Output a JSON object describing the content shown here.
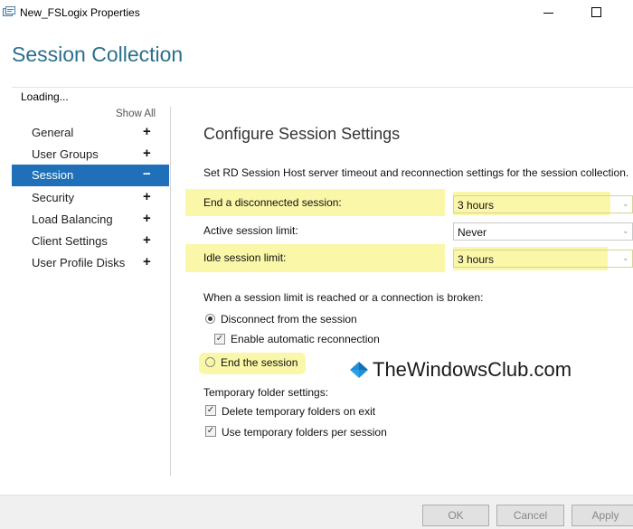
{
  "window": {
    "title": "New_FSLogix Properties",
    "icon": "properties-icon",
    "controls": [
      "minimize-icon",
      "maximize-icon"
    ]
  },
  "header": {
    "title": "Session Collection"
  },
  "status": {
    "loading": "Loading..."
  },
  "sidebar": {
    "show_all": "Show All",
    "items": [
      {
        "label": "General",
        "sign": "+",
        "active": false
      },
      {
        "label": "User Groups",
        "sign": "+",
        "active": false
      },
      {
        "label": "Session",
        "sign": "−",
        "active": true
      },
      {
        "label": "Security",
        "sign": "+",
        "active": false
      },
      {
        "label": "Load Balancing",
        "sign": "+",
        "active": false
      },
      {
        "label": "Client Settings",
        "sign": "+",
        "active": false
      },
      {
        "label": "User Profile Disks",
        "sign": "+",
        "active": false
      }
    ]
  },
  "main": {
    "title": "Configure Session Settings",
    "description": "Set RD Session Host server timeout and reconnection settings for the session collection.",
    "settings": [
      {
        "label": "End a disconnected session:",
        "value": "3 hours",
        "highlighted": true
      },
      {
        "label": "Active session limit:",
        "value": "Never",
        "highlighted": false
      },
      {
        "label": "Idle session limit:",
        "value": "3 hours",
        "highlighted": true
      }
    ],
    "limit_prompt": "When a session limit is reached or a connection is broken:",
    "radio_disconnect": "Disconnect from the session",
    "check_auto_reconnect": "Enable automatic reconnection",
    "radio_end": "End the session",
    "temp_folder_title": "Temporary folder settings:",
    "check_delete_temp": "Delete temporary folders on exit",
    "check_use_temp": "Use temporary folders per session"
  },
  "watermark": {
    "text": "TheWindowsClub.com",
    "logo_color": "#1f8fd6"
  },
  "footer": {
    "ok": "OK",
    "cancel": "Cancel",
    "apply": "Apply"
  },
  "colors": {
    "accent": "#1f70b8",
    "header": "#2b6f8e",
    "highlight": "#fbf7a8"
  }
}
